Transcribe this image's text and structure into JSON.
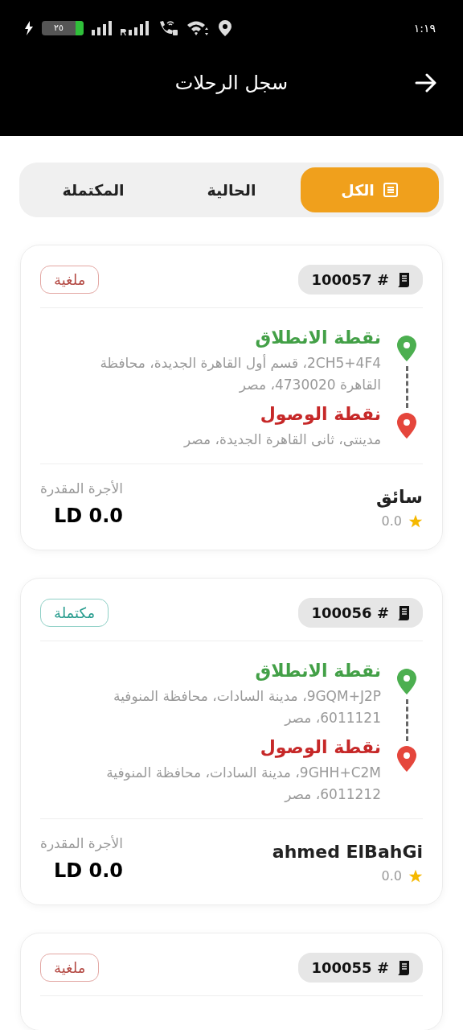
{
  "status_bar": {
    "battery": "٢٥",
    "time": "١:١٩"
  },
  "header": {
    "title": "سجل الرحلات"
  },
  "tabs": [
    {
      "label": "الكل",
      "selected": true
    },
    {
      "label": "الحالية",
      "selected": false
    },
    {
      "label": "المكتملة",
      "selected": false
    }
  ],
  "trips": [
    {
      "id": "# 100057",
      "kind": "cancelled",
      "status_label": "ملغية",
      "pickup_label": "نقطة الانطلاق",
      "pickup_address": "2CH5+4F4، قسم أول القاهرة الجديدة، محافظة القاهرة 4730020، مصر",
      "dropoff_label": "نقطة الوصول",
      "dropoff_address": "مدينتى، ثانى القاهرة الجديدة، مصر",
      "driver": "سائق",
      "rating": "0.0",
      "fare_label": "الأجرة المقدرة",
      "fare": "LD 0.0"
    },
    {
      "id": "# 100056",
      "kind": "completed",
      "status_label": "مكتملة",
      "pickup_label": "نقطة الانطلاق",
      "pickup_address": "9GQM+J2P، مدينة السادات، محافظة المنوفية 6011121، مصر",
      "dropoff_label": "نقطة الوصول",
      "dropoff_address": "9GHH+C2M، مدينة السادات، محافظة المنوفية 6011212، مصر",
      "driver": "ahmed ElBahGi",
      "rating": "0.0",
      "fare_label": "الأجرة المقدرة",
      "fare": "LD 0.0"
    },
    {
      "id": "# 100055",
      "kind": "cancelled",
      "status_label": "ملغية"
    }
  ]
}
